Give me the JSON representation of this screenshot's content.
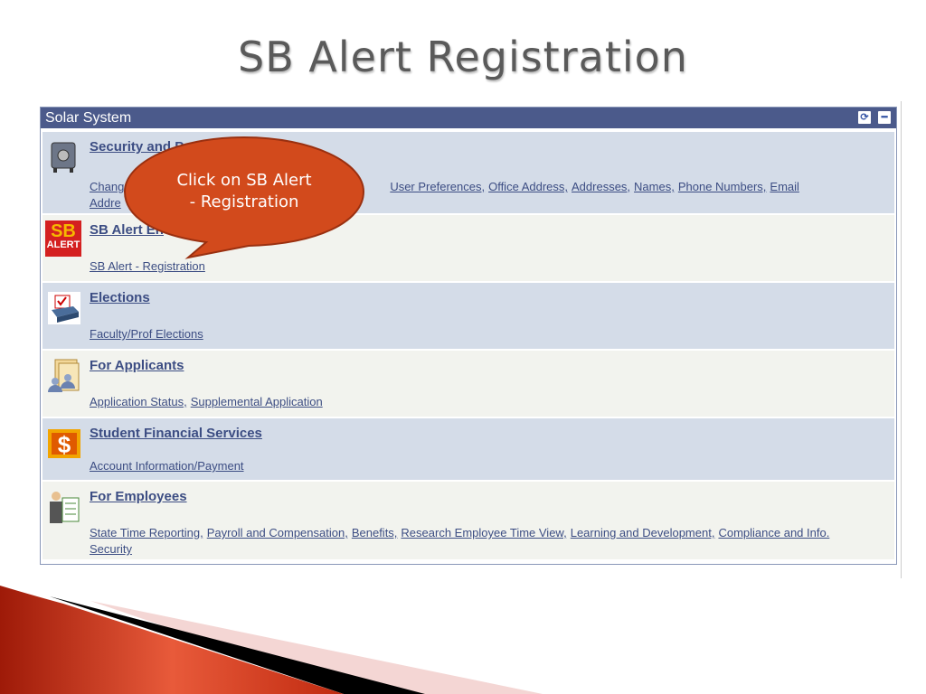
{
  "slide_title": "SB Alert Registration",
  "panel": {
    "title": "Solar System",
    "buttons": [
      {
        "icon": "refresh-icon"
      },
      {
        "icon": "minimize-icon"
      }
    ],
    "rows": [
      {
        "name": "Security and P",
        "icon": "safe-icon",
        "links": [
          "Chang",
          "User Preferences,",
          "Office Address,",
          "Addresses,",
          "Names,",
          "Phone Numbers,",
          "Email"
        ],
        "links2": [
          "Addre"
        ]
      },
      {
        "name": "SB Alert En",
        "icon": "sb-alert-icon",
        "links": [
          "SB Alert - Registration"
        ]
      },
      {
        "name": "Elections",
        "icon": "ballot-box-icon",
        "links": [
          "Faculty/Prof Elections"
        ]
      },
      {
        "name": "For Applicants",
        "icon": "applicants-icon",
        "links": [
          "Application Status,",
          "Supplemental Application"
        ]
      },
      {
        "name": "Student Financial Services",
        "icon": "dollar-icon",
        "links": [
          "Account Information/Payment"
        ]
      },
      {
        "name": "For Employees",
        "icon": "employee-checklist-icon",
        "links": [
          "State Time Reporting,",
          "Payroll and Compensation,",
          "Benefits,",
          "Research Employee Time View,",
          "Learning and Development,",
          "Compliance and Info."
        ],
        "links2": [
          "Security"
        ]
      }
    ]
  },
  "sb_alert_icon_text": [
    "SB",
    "ALERT"
  ],
  "callout": {
    "line1": "Click on SB Alert",
    "line2": "- Registration",
    "color": "#d24a1c"
  },
  "colors": {
    "header": "#4b5a8b",
    "row_blue": "#d4dce8",
    "row_light": "#f2f3ee",
    "link": "#3c4d83"
  }
}
